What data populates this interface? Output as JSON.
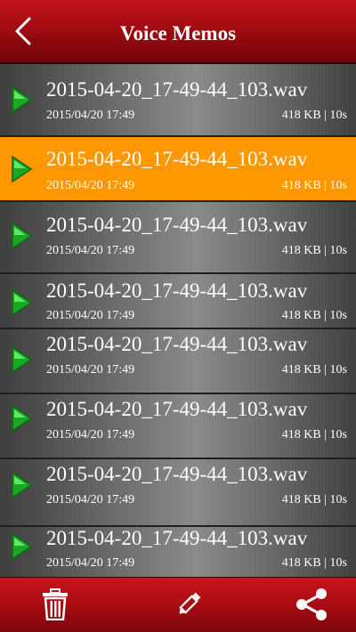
{
  "header": {
    "title": "Voice Memos",
    "back_icon": "chevron-left-icon"
  },
  "colors": {
    "header_red": "#b30f16",
    "selected_orange": "#ff9800",
    "play_green": "#22b42a",
    "text": "#ffffff"
  },
  "memos": [
    {
      "name": "2015-04-20_17-49-44_103.wav",
      "date": "2015/04/20 17:49",
      "size_duration": "418 KB | 10s",
      "selected": false
    },
    {
      "name": "2015-04-20_17-49-44_103.wav",
      "date": "2015/04/20 17:49",
      "size_duration": "418 KB | 10s",
      "selected": true
    },
    {
      "name": "2015-04-20_17-49-44_103.wav",
      "date": "2015/04/20 17:49",
      "size_duration": "418 KB | 10s",
      "selected": false
    },
    {
      "name": "2015-04-20_17-49-44_103.wav",
      "date": "2015/04/20 17:49",
      "size_duration": "418 KB | 10s",
      "selected": false
    },
    {
      "name": "2015-04-20_17-49-44_103.wav",
      "date": "2015/04/20 17:49",
      "size_duration": "418 KB | 10s",
      "selected": false
    },
    {
      "name": "2015-04-20_17-49-44_103.wav",
      "date": "2015/04/20 17:49",
      "size_duration": "418 KB | 10s",
      "selected": false
    },
    {
      "name": "2015-04-20_17-49-44_103.wav",
      "date": "2015/04/20 17:49",
      "size_duration": "418 KB | 10s",
      "selected": false
    },
    {
      "name": "2015-04-20_17-49-44_103.wav",
      "date": "2015/04/20 17:49",
      "size_duration": "418 KB | 10s",
      "selected": false
    }
  ],
  "footer": {
    "delete_icon": "trash-icon",
    "rename_icon": "pencil-icon",
    "share_icon": "share-icon"
  }
}
